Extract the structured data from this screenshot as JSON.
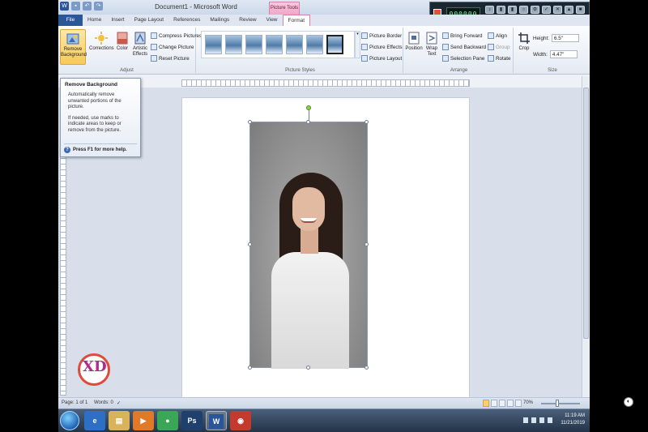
{
  "window": {
    "title": "Document1 - Microsoft Word",
    "contextual_tab": "Picture Tools",
    "led_text": "000000",
    "controls": [
      "–",
      "□",
      "✕"
    ]
  },
  "tabs": [
    "File",
    "Home",
    "Insert",
    "Page Layout",
    "References",
    "Mailings",
    "Review",
    "View",
    "Format"
  ],
  "ribbon": {
    "adjust": {
      "label": "Adjust",
      "remove_background": "Remove Background",
      "corrections": "Corrections",
      "color": "Color",
      "artistic_effects": "Artistic Effects",
      "compress_pictures": "Compress Pictures",
      "change_picture": "Change Picture",
      "reset_picture": "Reset Picture"
    },
    "picture_styles": {
      "label": "Picture Styles",
      "picture_border": "Picture Border",
      "picture_effects": "Picture Effects",
      "picture_layout": "Picture Layout"
    },
    "arrange": {
      "label": "Arrange",
      "position": "Position",
      "wrap_text": "Wrap Text",
      "bring_forward": "Bring Forward",
      "send_backward": "Send Backward",
      "selection_pane": "Selection Pane",
      "align": "Align",
      "group": "Group",
      "rotate": "Rotate"
    },
    "size": {
      "label": "Size",
      "crop": "Crop",
      "height_label": "Height:",
      "height_value": "6.5\"",
      "width_label": "Width:",
      "width_value": "4.47\""
    }
  },
  "tooltip": {
    "title": "Remove Background",
    "line1": "Automatically remove unwanted portions of the picture.",
    "line2": "If needed, use marks to indicate areas to keep or remove from the picture.",
    "help": "Press F1 for more help."
  },
  "statusbar": {
    "page": "Page: 1 of 1",
    "words": "Words: 0",
    "zoom": "70%"
  },
  "taskbar": {
    "time": "11:19 AM",
    "date": "11/21/2019",
    "apps": [
      "ie-icon",
      "explorer-icon",
      "media-icon",
      "chrome-icon",
      "photoshop-icon",
      "word-icon",
      "recorder-icon"
    ]
  },
  "colors": {
    "file_tab": "#2b5797",
    "contextual_tab": "#f0a6c6",
    "active_button": "#f7c95a"
  }
}
